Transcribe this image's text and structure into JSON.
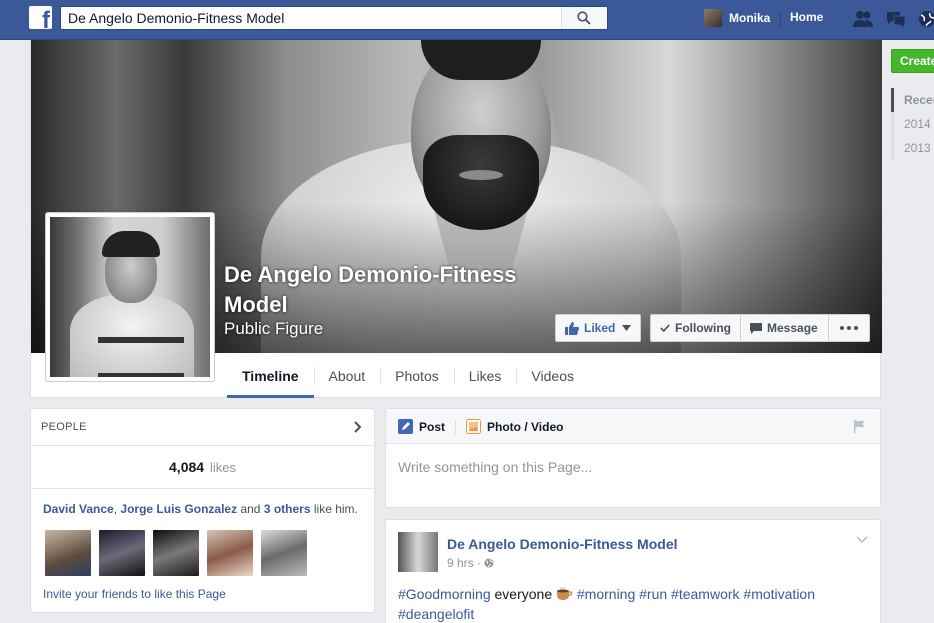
{
  "topbar": {
    "search_value": "De Angelo Demonio-Fitness Model",
    "user_name": "Monika",
    "home_label": "Home"
  },
  "page": {
    "name": "De Angelo Demonio-Fitness Model",
    "category": "Public Figure"
  },
  "cover_buttons": {
    "liked": "Liked",
    "following": "Following",
    "message": "Message"
  },
  "tabs": [
    {
      "label": "Timeline"
    },
    {
      "label": "About"
    },
    {
      "label": "Photos"
    },
    {
      "label": "Likes"
    },
    {
      "label": "Videos"
    }
  ],
  "sidebar_right": {
    "create_label": "Create",
    "years": [
      "Recent",
      "2014",
      "2013"
    ]
  },
  "people": {
    "title": "PEOPLE",
    "likes_count": "4,084",
    "likes_word": "likes",
    "friend1": "David Vance",
    "sep": ",",
    "friend2": "Jorge Luis Gonzalez",
    "and": "and",
    "others": "3 others",
    "like_him": "like him.",
    "invite": "Invite your friends to like this Page"
  },
  "composer": {
    "post_tab": "Post",
    "photo_tab": "Photo / Video",
    "placeholder": "Write something on this Page..."
  },
  "post": {
    "author": "De Angelo Demonio-Fitness Model",
    "time": "9 hrs",
    "dot": "·",
    "text_tag1": "#Goodmorning",
    "text_plain": " everyone ",
    "text_tags": " #morning #run #teamwork #motivation",
    "text_tag_last": "#deangelofit"
  },
  "colors": {
    "brand": "#3b5998",
    "create_green": "#42b72a"
  }
}
